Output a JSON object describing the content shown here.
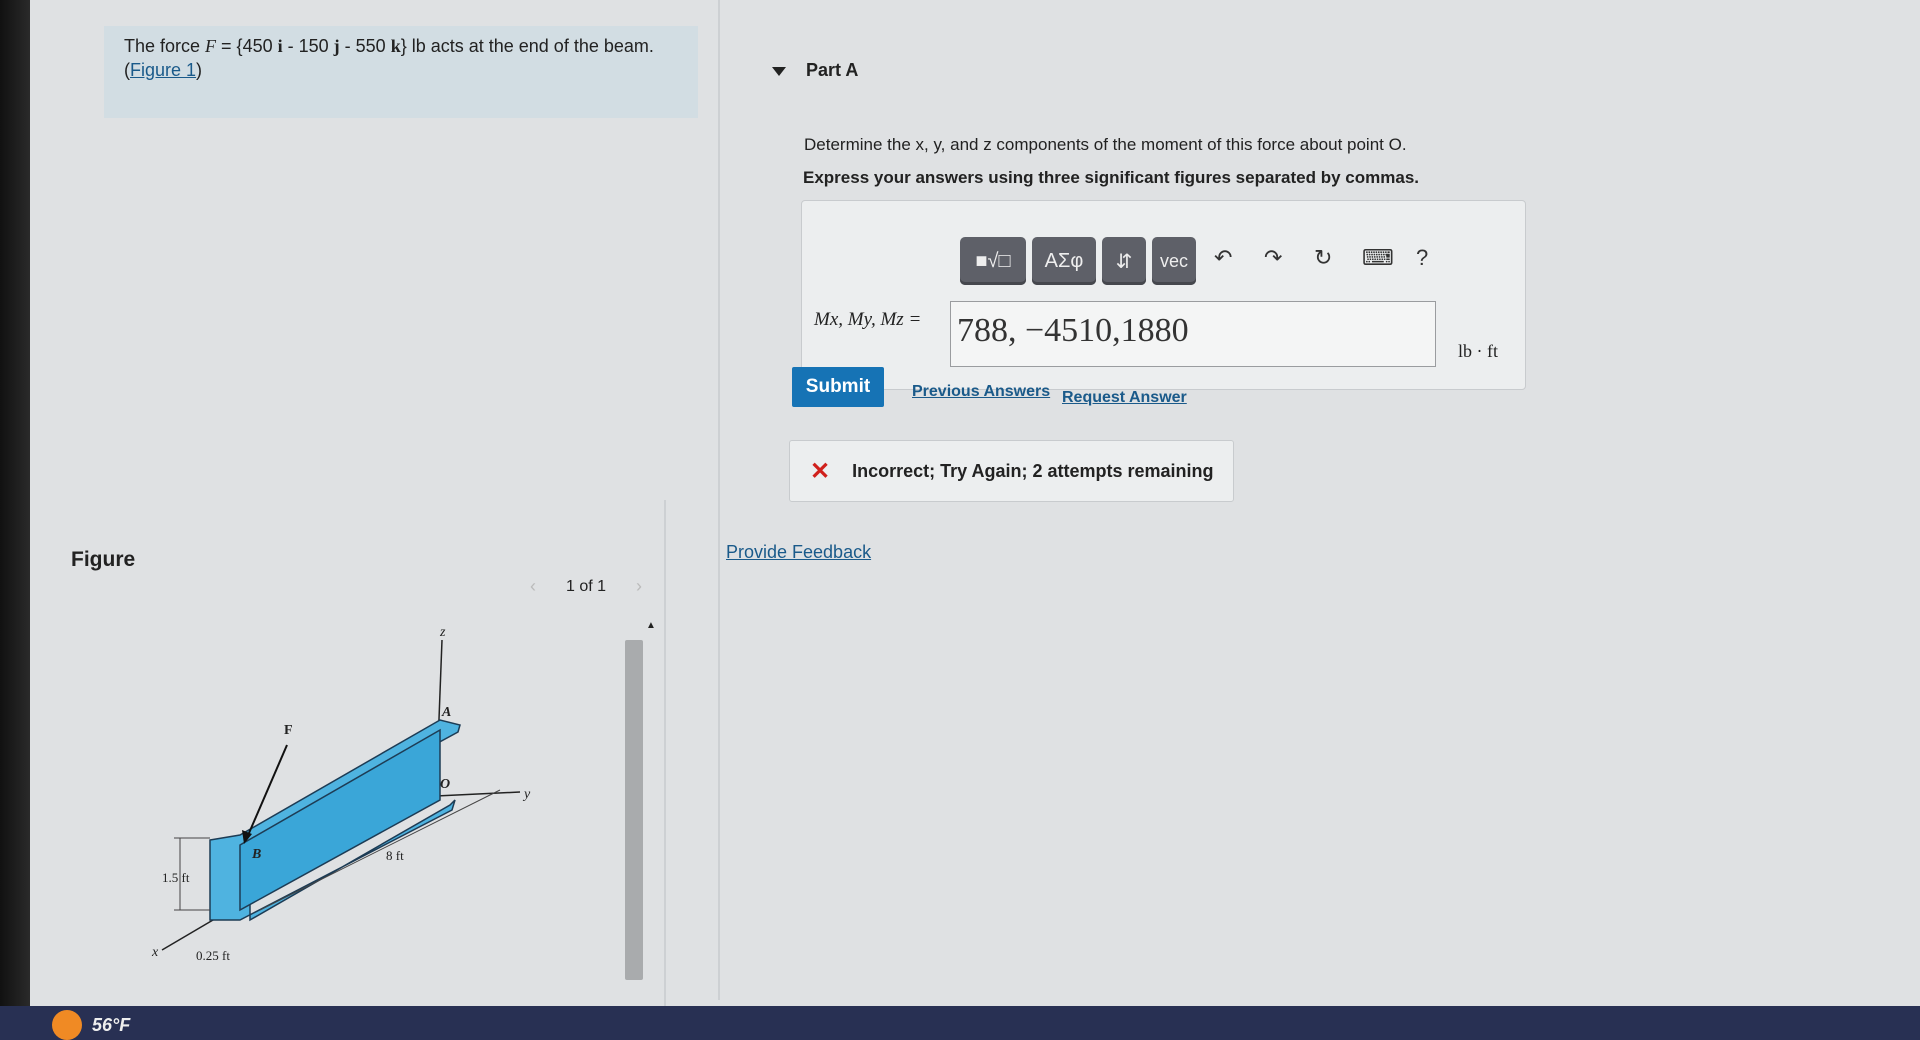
{
  "problem": {
    "text_prefix": "The force ",
    "F": "F",
    "eq": " = {450 ",
    "i": "i",
    "m1": " - 150 ",
    "j": "j",
    "m2": " - 550 ",
    "k": "k",
    "suffix": "} lb acts at the end of the beam.",
    "figure_link": "Figure 1"
  },
  "part": {
    "title": "Part A",
    "question": "Determine the x, y, and z components of the moment of this force about point O.",
    "instruction": "Express your answers using three significant figures separated by commas."
  },
  "toolbar": {
    "templates": "■√□",
    "greek": "ΑΣφ",
    "arrows": "⇵",
    "vec": "vec",
    "undo": "↶",
    "redo": "↷",
    "reset": "↻",
    "keyboard": "⌨",
    "help": "?"
  },
  "answer": {
    "label": "Mx, My, Mz =",
    "value": "788, −4510,1880",
    "unit": "lb · ft"
  },
  "actions": {
    "submit": "Submit",
    "previous": "Previous Answers",
    "request": "Request Answer"
  },
  "feedback": {
    "icon": "✕",
    "message": "Incorrect; Try Again; 2 attempts remaining",
    "provide": "Provide Feedback"
  },
  "figure_panel": {
    "title": "Figure",
    "pager": "1 of 1",
    "prev": "‹",
    "next": "›"
  },
  "diagram": {
    "z": "z",
    "y": "y",
    "x": "x",
    "A": "A",
    "O": "O",
    "B": "B",
    "F": "F",
    "d1": "1.5 ft",
    "d2": "8 ft",
    "d3": "0.25 ft"
  },
  "taskbar": {
    "weather": "56°F"
  },
  "colors": {
    "submit": "#1673b5",
    "error": "#d0201c",
    "beam": "#4fb3e0"
  }
}
